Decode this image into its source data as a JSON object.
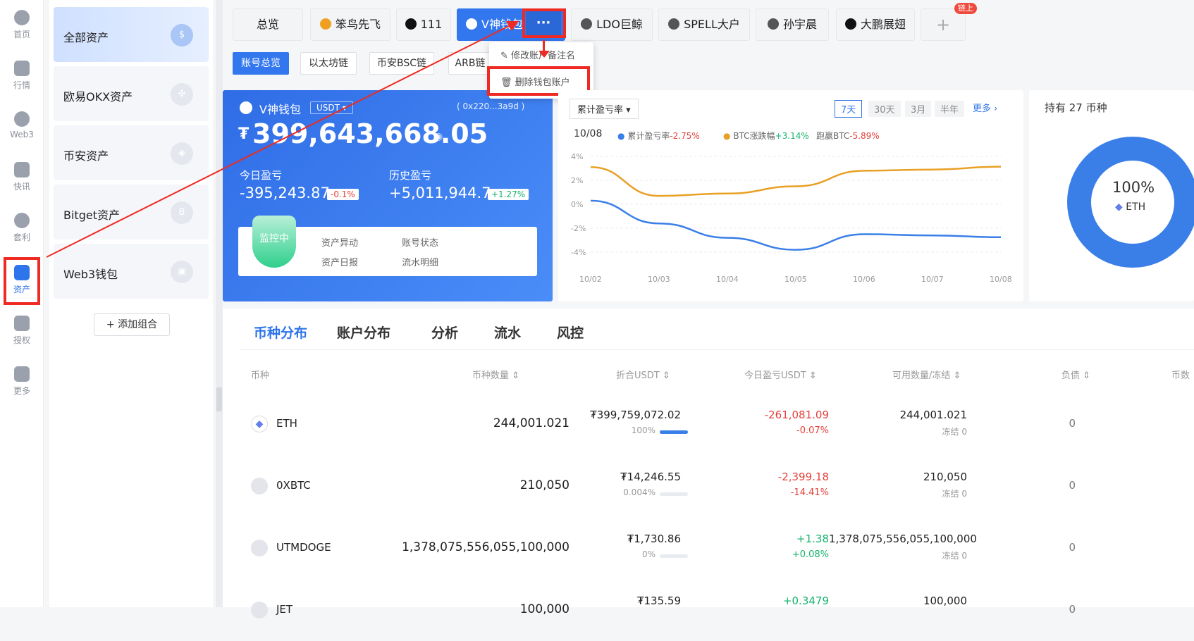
{
  "rail": [
    {
      "label": "首页",
      "icon": "globe-icon"
    },
    {
      "label": "行情",
      "icon": "bar-chart-icon"
    },
    {
      "label": "Web3",
      "icon": "web3-icon"
    },
    {
      "label": "快讯",
      "icon": "news-icon"
    },
    {
      "label": "套利",
      "icon": "arbitrage-icon"
    },
    {
      "label": "资产",
      "icon": "wallet-icon"
    },
    {
      "label": "授权",
      "icon": "authorize-icon"
    },
    {
      "label": "更多",
      "icon": "more-grid-icon"
    }
  ],
  "groups": [
    {
      "label": "全部资产",
      "icon": "$"
    },
    {
      "label": "欧易OKX资产",
      "icon": "✣"
    },
    {
      "label": "币安资产",
      "icon": "◈"
    },
    {
      "label": "Bitget资产",
      "icon": "B"
    },
    {
      "label": "Web3钱包",
      "icon": "▣"
    }
  ],
  "add_combo": "+ 添加组合",
  "tabs": [
    "总览",
    "笨鸟先飞",
    "111",
    "V神钱包",
    "LDO巨鲸",
    "SPELL大户",
    "孙宇晨",
    "大鹏展翅",
    "+"
  ],
  "tab_more": "···",
  "tab_badge": "链上",
  "subtabs": [
    "账号总览",
    "以太坊链",
    "币安BSC链",
    "ARB链"
  ],
  "menu": {
    "rename": "修改账户备注名",
    "delete": "删除钱包账户"
  },
  "wallet": {
    "name": "V神钱包",
    "currency": "USDT",
    "address": "( 0x220...3a9d )",
    "total": "399,643,668.05",
    "currency_symbol": "₮",
    "today_label": "今日盈亏",
    "today_value": "-395,243.87",
    "today_pct": "-0.1%",
    "hist_label": "历史盈亏",
    "hist_value": "+5,011,944.7",
    "hist_pct": "+1.27%",
    "monitor": "监控中",
    "checks": [
      "资产异动",
      "账号状态",
      "资产日报",
      "流水明细"
    ]
  },
  "pnl": {
    "select": "累计盈亏率",
    "ranges": [
      "7天",
      "30天",
      "3月",
      "半年"
    ],
    "more": "更多",
    "date": "10/08",
    "legend": [
      {
        "name": "累计盈亏率",
        "value": "-2.75%",
        "color": "#3a7ee8"
      },
      {
        "name": "BTC涨跌幅",
        "value": "+3.14%",
        "color": "#e8a025"
      },
      {
        "name": "跑赢BTC",
        "value": "-5.89%"
      }
    ]
  },
  "chart_data": {
    "type": "line",
    "x": [
      "10/02",
      "10/03",
      "10/04",
      "10/05",
      "10/06",
      "10/07",
      "10/08"
    ],
    "yticks": [
      "4%",
      "2%",
      "0%",
      "-2%",
      "-4%"
    ],
    "ylim": [
      -4,
      4
    ],
    "series": [
      {
        "name": "累计盈亏率",
        "color": "#3a7ee8",
        "values": [
          0.3,
          -1.6,
          -2.8,
          -3.8,
          -2.5,
          -2.6,
          -2.75
        ]
      },
      {
        "name": "BTC涨跌幅",
        "color": "#e8a025",
        "values": [
          3.1,
          0.7,
          0.9,
          1.5,
          2.8,
          2.9,
          3.14
        ]
      }
    ]
  },
  "hold": {
    "title": "持有 27 币种",
    "pct": "100%",
    "coin": "ETH"
  },
  "table": {
    "tabs": [
      "币种分布",
      "账户分布",
      "分析",
      "流水",
      "风控"
    ],
    "headers": [
      "币种",
      "币种数量 ⇕",
      "折合USDT ⇕",
      "今日盈亏USDT ⇕",
      "可用数量/冻结 ⇕",
      "负债 ⇕",
      "币数"
    ],
    "rows": [
      {
        "coin": "ETH",
        "qty": "244,001.021",
        "usdt": "₮399,759,072.02",
        "share": "100%",
        "share_val": 100,
        "pnl": "-261,081.09",
        "pnl_pct": "-0.07%",
        "pnl_pos": false,
        "avail": "244,001.021",
        "frozen": "冻结 0",
        "debt": "0"
      },
      {
        "coin": "0XBTC",
        "qty": "210,050",
        "usdt": "₮14,246.55",
        "share": "0.004%",
        "share_val": 0.004,
        "pnl": "-2,399.18",
        "pnl_pct": "-14.41%",
        "pnl_pos": false,
        "avail": "210,050",
        "frozen": "冻结 0",
        "debt": "0"
      },
      {
        "coin": "UTMDOGE",
        "qty": "1,378,075,556,055,100,000",
        "usdt": "₮1,730.86",
        "share": "0%",
        "share_val": 0,
        "pnl": "+1.38",
        "pnl_pct": "+0.08%",
        "pnl_pos": true,
        "avail": "1,378,075,556,055,100,000",
        "frozen": "冻结 0",
        "debt": "0"
      },
      {
        "coin": "JET",
        "qty": "100,000",
        "usdt": "₮135.59",
        "share": "",
        "share_val": 0,
        "pnl": "+0.3479",
        "pnl_pct": "",
        "pnl_pos": true,
        "avail": "100,000",
        "frozen": "",
        "debt": "0"
      }
    ]
  }
}
